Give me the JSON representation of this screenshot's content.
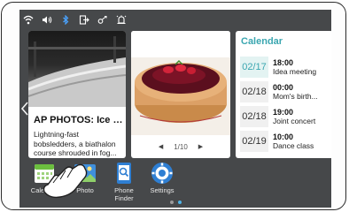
{
  "status_icons": [
    "wifi-icon",
    "volume-icon",
    "bluetooth-icon",
    "sign-out-icon",
    "screen-mirror-icon",
    "alarm-icon"
  ],
  "news": {
    "title": "AP PHOTOS: Ice an...",
    "snippet": [
      "Lightning-fast",
      "bobsledders, a biathalon",
      "course shrouded in fog..."
    ]
  },
  "photo": {
    "page": "1/10",
    "prev": "◀",
    "next": "▶"
  },
  "calendar": {
    "header": "Calendar",
    "events": [
      {
        "date": "02/17",
        "time": "18:00",
        "title": "Idea meeting",
        "today": true
      },
      {
        "date": "02/18",
        "time": "00:00",
        "title": "Mom's birth...",
        "today": false
      },
      {
        "date": "02/18",
        "time": "19:00",
        "title": "Joint concert",
        "today": false
      },
      {
        "date": "02/19",
        "time": "10:00",
        "title": "Dance class",
        "today": false
      }
    ]
  },
  "apps": [
    {
      "label": "Calendar",
      "icon": "calendar-icon"
    },
    {
      "label": "Photo",
      "icon": "photo-icon"
    },
    {
      "label": "Phone\nFinder",
      "icon": "phone-finder-icon"
    },
    {
      "label": "Settings",
      "icon": "settings-icon"
    }
  ],
  "page_indicator": {
    "count": 2,
    "active": 1
  },
  "colors": {
    "accent": "#3aa6b0",
    "screen_bg": "#46484a",
    "active_dot": "#4fb4e8"
  }
}
